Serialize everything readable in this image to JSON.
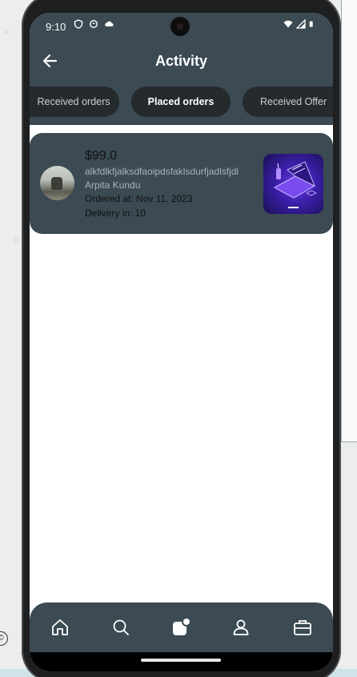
{
  "status_bar": {
    "time": "9:10"
  },
  "header": {
    "title": "Activity"
  },
  "tabs": [
    {
      "label": "Received orders",
      "active": false
    },
    {
      "label": "Placed orders",
      "active": true
    },
    {
      "label": "Received Offer",
      "active": false
    }
  ],
  "orders": [
    {
      "price": "$99.0",
      "description": "alkfdlkfjalksdfaoipdsfaklsdurfjadlsfjdl",
      "seller": "Arpita Kundu",
      "ordered_at": "Ordered at: Nov 11, 2023",
      "delivery": "Delivery in: 10"
    }
  ],
  "bottom_nav": [
    {
      "icon": "home-icon"
    },
    {
      "icon": "search-icon"
    },
    {
      "icon": "activity-icon",
      "active": true
    },
    {
      "icon": "profile-icon"
    },
    {
      "icon": "briefcase-icon"
    }
  ],
  "colors": {
    "header_bg": "#3b4a53",
    "card_bg": "#3b4a53",
    "tab_bg": "#252a2d",
    "screen_bg": "#ffffff"
  }
}
